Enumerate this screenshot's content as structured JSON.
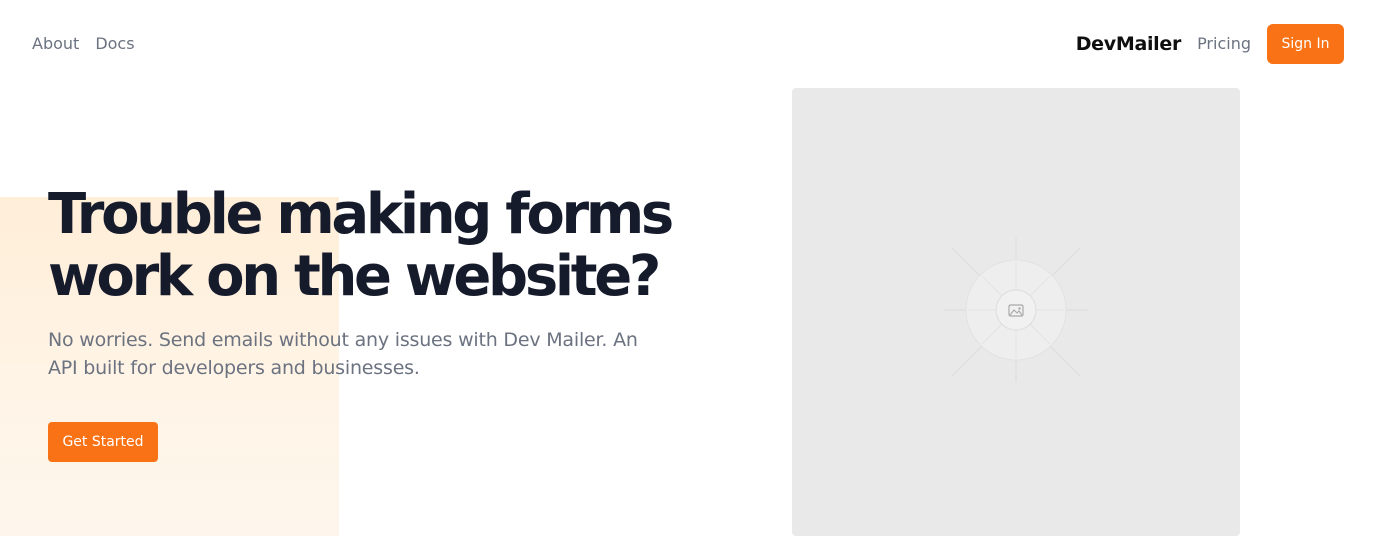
{
  "nav": {
    "links": [
      "About",
      "Docs"
    ],
    "brand": "DevMailer",
    "pricing": "Pricing",
    "signin": "Sign In"
  },
  "hero": {
    "title_line1": "Trouble making forms",
    "title_line2": "work on the website?",
    "subtitle": "No worries. Send emails without any issues with Dev Mailer. An API built for developers and businesses.",
    "cta": "Get Started"
  },
  "media": {
    "icon": "image-placeholder-icon"
  },
  "colors": {
    "accent": "#f97316",
    "heading": "#161b2c",
    "muted": "#6b7280",
    "peach": "#ffeed8",
    "placeholder": "#e9e9e9"
  }
}
